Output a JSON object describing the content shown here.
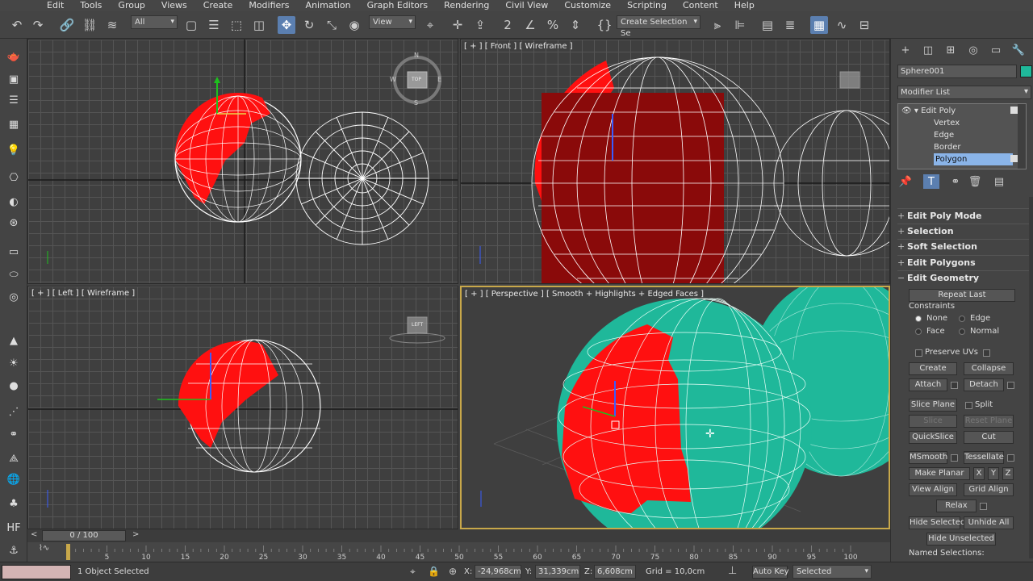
{
  "menu": [
    "Edit",
    "Tools",
    "Group",
    "Views",
    "Create",
    "Modifiers",
    "Animation",
    "Graph Editors",
    "Rendering",
    "Civil View",
    "Customize",
    "Scripting",
    "Content",
    "Help"
  ],
  "toolbar": {
    "filter_value": "All",
    "view_value": "View",
    "selection_set_placeholder": "Create Selection Se"
  },
  "viewports": {
    "top": {
      "label": ""
    },
    "front": {
      "label": "[ + ] [ Front ] [ Wireframe ]"
    },
    "left": {
      "label": "[ + ] [ Left ] [ Wireframe ]"
    },
    "perspective": {
      "label": "[ + ] [ Perspective ] [ Smooth + Highlights + Edged Faces ]"
    },
    "viewcube": {
      "top": "TOP",
      "left": "LEFT",
      "n": "N",
      "s": "S",
      "e": "E",
      "w": "W"
    }
  },
  "command_panel": {
    "object_name": "Sphere001",
    "object_color": "#1fb89a",
    "modifier_list": "Modifier List",
    "stack": [
      {
        "label": "Edit Poly",
        "level": 0
      },
      {
        "label": "Vertex",
        "level": 1
      },
      {
        "label": "Edge",
        "level": 1
      },
      {
        "label": "Border",
        "level": 1
      },
      {
        "label": "Polygon",
        "level": 1,
        "selected": true
      }
    ],
    "rollouts": [
      "Edit Poly Mode",
      "Selection",
      "Soft Selection",
      "Edit Polygons",
      "Edit Geometry"
    ],
    "edit_geometry": {
      "repeat_last": "Repeat Last",
      "constraints": "Constraints",
      "none": "None",
      "edge": "Edge",
      "face": "Face",
      "normal": "Normal",
      "preserve_uvs": "Preserve UVs",
      "create": "Create",
      "collapse": "Collapse",
      "attach": "Attach",
      "detach": "Detach",
      "slice_plane": "Slice Plane",
      "split": "Split",
      "slice": "Slice",
      "reset_plane": "Reset Plane",
      "quickslice": "QuickSlice",
      "cut": "Cut",
      "msmooth": "MSmooth",
      "tessellate": "Tessellate",
      "make_planar": "Make Planar",
      "x": "X",
      "y": "Y",
      "z": "Z",
      "view_align": "View Align",
      "grid_align": "Grid Align",
      "relax": "Relax",
      "hide_selected": "Hide Selected",
      "unhide_all": "Unhide All",
      "hide_unselected": "Hide Unselected",
      "named_selections": "Named Selections:"
    }
  },
  "timeline": {
    "frame_display": "0 / 100",
    "ticks": [
      "0",
      "5",
      "10",
      "15",
      "20",
      "25",
      "30",
      "35",
      "40",
      "45",
      "50",
      "55",
      "60",
      "65",
      "70",
      "75",
      "80",
      "85",
      "90",
      "95",
      "100"
    ]
  },
  "status": {
    "selection": "1 Object Selected",
    "x_label": "X:",
    "x_value": "-24,968cm",
    "y_label": "Y:",
    "y_value": "31,339cm",
    "z_label": "Z:",
    "z_value": "6,608cm",
    "grid": "Grid = 10,0cm",
    "auto_key": "Auto Key",
    "selected_dropdown": "Selected"
  },
  "colors": {
    "selection_red": "#ff0000",
    "mesh_teal": "#1fb89a",
    "active_border": "#c8a84a",
    "highlight_blue": "#5b7fb0"
  }
}
